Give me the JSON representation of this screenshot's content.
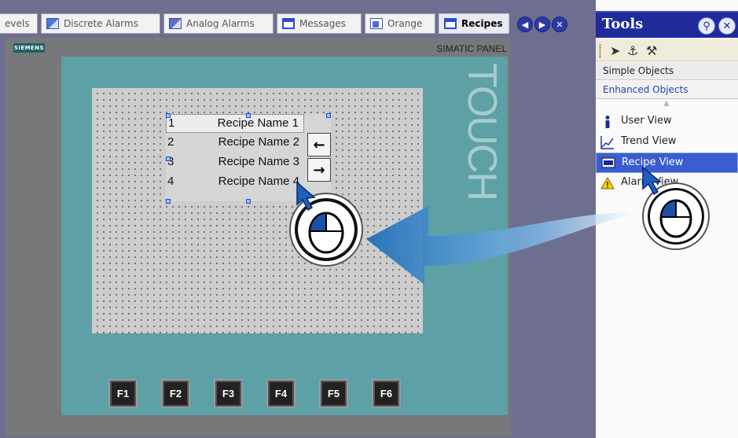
{
  "tabs": [
    {
      "label": "evels",
      "icon": "none"
    },
    {
      "label": "Discrete Alarms",
      "icon": "discrete-alarms-icon"
    },
    {
      "label": "Analog Alarms",
      "icon": "analog-alarms-icon"
    },
    {
      "label": "Messages",
      "icon": "window-icon"
    },
    {
      "label": "Orange",
      "icon": "screen-icon"
    },
    {
      "label": "Recipes",
      "icon": "window-icon",
      "active": true
    }
  ],
  "nav": {
    "prev": "◀",
    "next": "▶",
    "close": "✕"
  },
  "device": {
    "logo": "SIEMENS",
    "panel_name": "SIMATIC PANEL",
    "brand_text": "TOUCH",
    "fkeys": [
      "F1",
      "F2",
      "F3",
      "F4",
      "F5",
      "F6"
    ]
  },
  "recipe_view": {
    "rows": [
      {
        "num": "1",
        "name": "Recipe Name 1"
      },
      {
        "num": "2",
        "name": "Recipe Name 2"
      },
      {
        "num": "3",
        "name": "Recipe Name 3"
      },
      {
        "num": "4",
        "name": "Recipe Name 4"
      }
    ],
    "btn_prev": "←",
    "btn_next": "→"
  },
  "tools": {
    "title": "Tools",
    "sections": [
      "Simple Objects",
      "Enhanced Objects"
    ],
    "items": [
      {
        "label": "User View",
        "icon": "user-icon"
      },
      {
        "label": "Trend View",
        "icon": "trend-icon"
      },
      {
        "label": "Recipe View",
        "icon": "recipe-icon",
        "selected": true
      },
      {
        "label": "Alarm View",
        "icon": "warning-icon"
      }
    ]
  },
  "colors": {
    "accent": "#1f2b9a",
    "selection": "#3a5ed0",
    "bezel": "#5da0a6",
    "arrow": "#2b7fc1"
  }
}
